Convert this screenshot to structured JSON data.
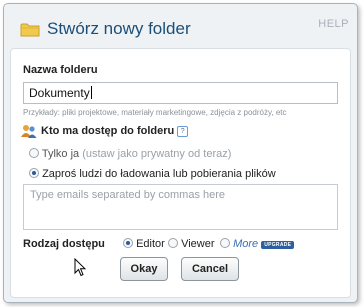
{
  "dialog": {
    "title": "Stwórz nowy folder",
    "help_label": "HELP",
    "folder_name_label": "Nazwa folderu",
    "folder_name_value": "Dokumenty",
    "examples_hint": "Przykłady: pliki projektowe, materiały marketingowe, zdjęcia z podróży, etc",
    "access_heading": "Kto ma dostęp do folderu",
    "info_glyph": "?",
    "option_only_me": "Tylko ja",
    "option_only_me_note": "(ustaw jako prywatny od teraz)",
    "option_invite": "Zaproś ludzi do ładowania lub pobierania plików",
    "emails_placeholder": "Type emails separated by commas here",
    "access_type_label": "Rodzaj dostępu",
    "perm_editor": "Editor",
    "perm_viewer": "Viewer",
    "perm_more": "More",
    "upgrade_badge": "UPGRADE",
    "ok_button": "Okay",
    "cancel_button": "Cancel"
  },
  "state": {
    "selected_access": "invite",
    "selected_permission": "editor"
  },
  "colors": {
    "title": "#1c4e78",
    "link": "#3a6fb3",
    "badge": "#2f5f9e"
  },
  "icons": [
    "folder-icon",
    "people-icon",
    "info-icon",
    "mouse-cursor-icon"
  ]
}
